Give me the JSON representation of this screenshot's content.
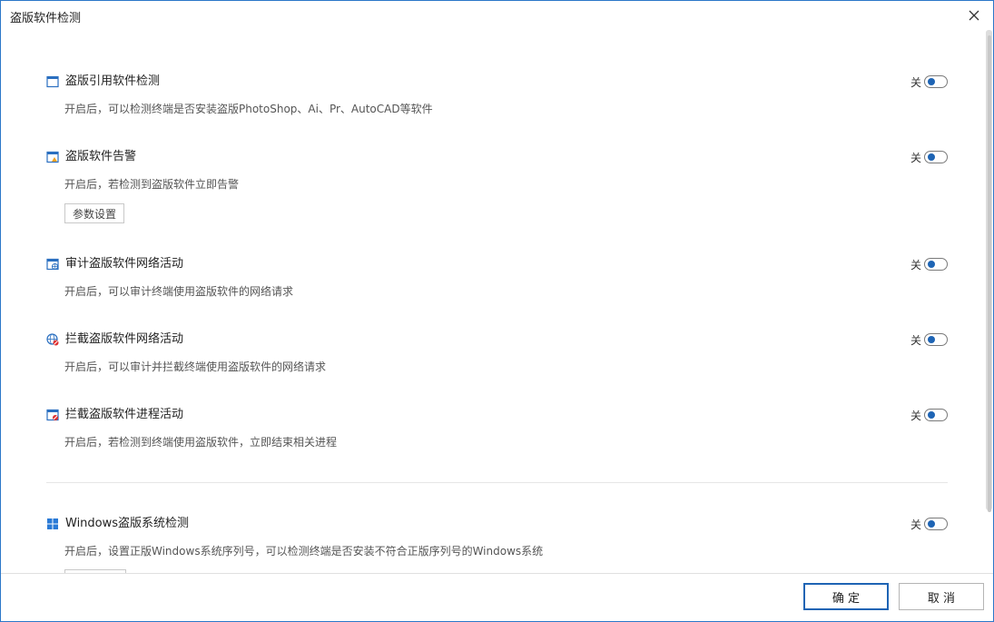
{
  "window": {
    "title": "盗版软件检测",
    "close_icon": "close-icon"
  },
  "sections": [
    {
      "icon": "window-icon",
      "title": "盗版引用软件检测",
      "desc": "开启后，可以检测终端是否安装盗版PhotoShop、Ai、Pr、AutoCAD等软件",
      "toggle_label": "关"
    },
    {
      "icon": "window-alert-icon",
      "title": "盗版软件告警",
      "desc": "开启后，若检测到盗版软件立即告警",
      "toggle_label": "关",
      "button": "参数设置"
    },
    {
      "icon": "window-network-icon",
      "title": "审计盗版软件网络活动",
      "desc": "开启后，可以审计终端使用盗版软件的网络请求",
      "toggle_label": "关"
    },
    {
      "icon": "globe-block-icon",
      "title": "拦截盗版软件网络活动",
      "desc": "开启后，可以审计并拦截终端使用盗版软件的网络请求",
      "toggle_label": "关"
    },
    {
      "icon": "window-block-icon",
      "title": "拦截盗版软件进程活动",
      "desc": "开启后，若检测到终端使用盗版软件，立即结束相关进程",
      "toggle_label": "关"
    },
    {
      "icon": "windows-logo-icon",
      "title": "Windows盗版系统检测",
      "desc": "开启后，设置正版Windows系统序列号，可以检测终端是否安装不符合正版序列号的Windows系统",
      "toggle_label": "关"
    }
  ],
  "footer": {
    "ok": "确 定",
    "cancel": "取 消"
  },
  "colors": {
    "accent": "#1e64b4",
    "border": "#2b77c9"
  }
}
